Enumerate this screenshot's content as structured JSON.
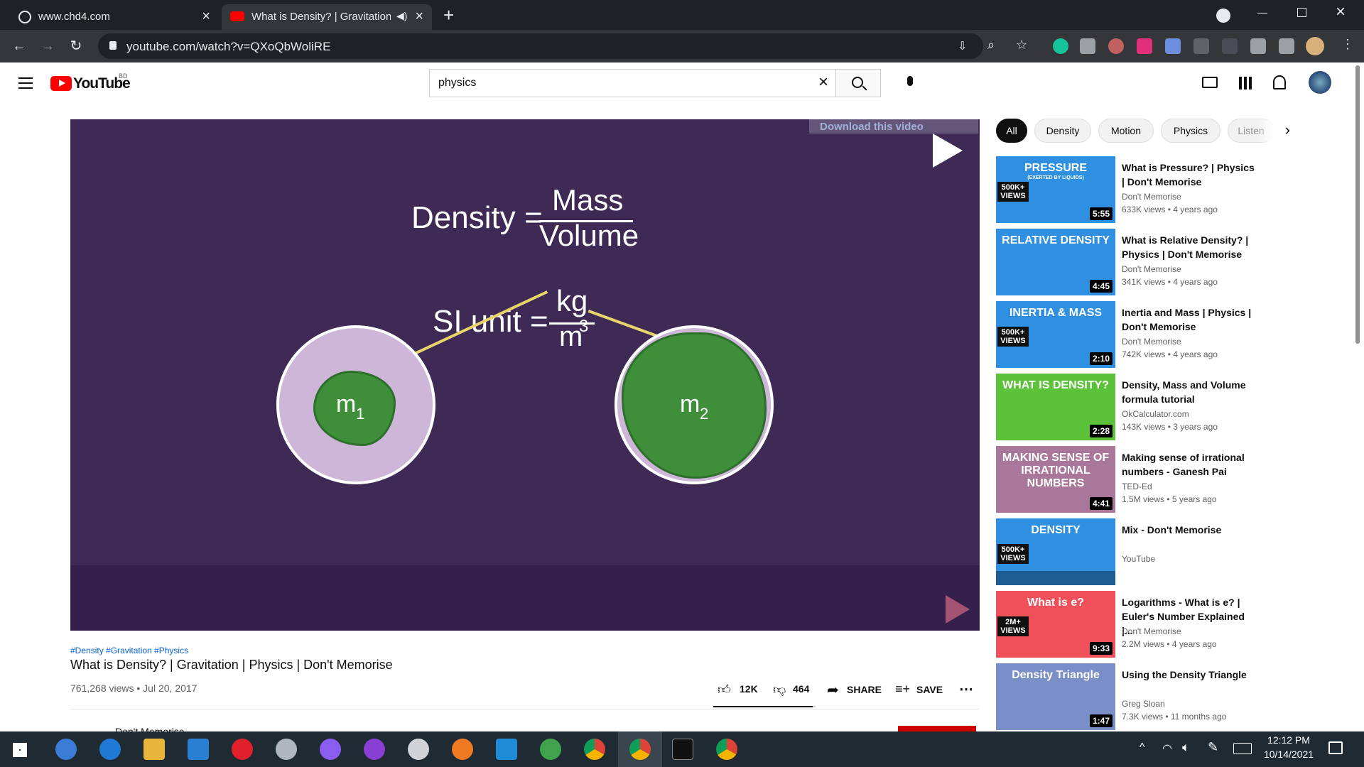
{
  "browser": {
    "tabs": [
      {
        "title": "www.chd4.com",
        "active": false
      },
      {
        "title": "What is Density? | Gravitation",
        "active": true
      }
    ],
    "url": "youtube.com/watch?v=QXoQbWoliRE"
  },
  "youtube": {
    "logo_text": "YouTube",
    "logo_region": "BD",
    "search_value": "physics"
  },
  "player": {
    "download_label": "Download this video",
    "formula_density_left": "Density =",
    "formula_mass": "Mass",
    "formula_volume": "Volume",
    "si_unit_left": "SI unit =",
    "si_kg": "kg",
    "si_m": "m",
    "si_exp": "3",
    "m1_label": "m",
    "m1_sub": "1",
    "m2_label": "m",
    "m2_sub": "2"
  },
  "video_info": {
    "hashtags": "#Density #Gravitation #Physics",
    "title": "What is Density? | Gravitation | Physics | Don't Memorise",
    "views_date": "761,268 views • Jul 20, 2017",
    "likes": "12K",
    "dislikes": "464",
    "share_label": "SHARE",
    "save_label": "SAVE",
    "channel_partial": "Don't Memorise"
  },
  "chips": [
    "All",
    "Density",
    "Motion",
    "Physics",
    "Listen"
  ],
  "recommendations": [
    {
      "title": "What is Pressure? | Physics | Don't Memorise",
      "channel": "Don't Memorise",
      "meta": "633K views • 4 years ago",
      "duration": "5:55",
      "thumb_text": "PRESSURE",
      "thumb_sub": "(EXERTED BY LIQUIDS)",
      "badge": "500K+ VIEWS",
      "color": "#2f8fe0"
    },
    {
      "title": "What is Relative Density? | Physics | Don't Memorise",
      "channel": "Don't Memorise",
      "meta": "341K views • 4 years ago",
      "duration": "4:45",
      "thumb_text": "RELATIVE DENSITY",
      "thumb_sub": "",
      "badge": "",
      "color": "#2f8fe0"
    },
    {
      "title": "Inertia and Mass | Physics | Don't Memorise",
      "channel": "Don't Memorise",
      "meta": "742K views • 4 years ago",
      "duration": "2:10",
      "thumb_text": "INERTIA & MASS",
      "thumb_sub": "",
      "badge": "500K+ VIEWS",
      "color": "#2f8fe0"
    },
    {
      "title": "Density, Mass and Volume formula tutorial",
      "channel": "OkCalculator.com",
      "meta": "143K views • 3 years ago",
      "duration": "2:28",
      "thumb_text": "WHAT IS DENSITY?",
      "thumb_sub": "",
      "badge": "",
      "color": "#5cc23a"
    },
    {
      "title": "Making sense of irrational numbers - Ganesh Pai",
      "channel": "TED-Ed",
      "meta": "1.5M views • 5 years ago",
      "duration": "4:41",
      "thumb_text": "MAKING SENSE OF IRRATIONAL NUMBERS",
      "thumb_sub": "",
      "badge": "",
      "color": "#a9779a"
    },
    {
      "title": "Mix - Don't Memorise",
      "channel": "YouTube",
      "meta": "",
      "duration": "",
      "thumb_text": "DENSITY",
      "thumb_sub": "",
      "badge": "500K+ VIEWS",
      "color": "#2f8fe0"
    },
    {
      "title": "Logarithms - What is e? | Euler's Number Explained |...",
      "channel": "Don't Memorise",
      "meta": "2.2M views • 4 years ago",
      "duration": "9:33",
      "thumb_text": "What is e?",
      "thumb_sub": "",
      "badge": "2M+ VIEWS",
      "color": "#f0505a"
    },
    {
      "title": "Using the Density Triangle",
      "channel": "Greg Sloan",
      "meta": "7.3K views • 11 months ago",
      "duration": "1:47",
      "thumb_text": "Density Triangle",
      "thumb_sub": "",
      "badge": "",
      "color": "#7a8fc8"
    }
  ],
  "taskbar": {
    "time": "12:12 PM",
    "date": "10/14/2021"
  }
}
